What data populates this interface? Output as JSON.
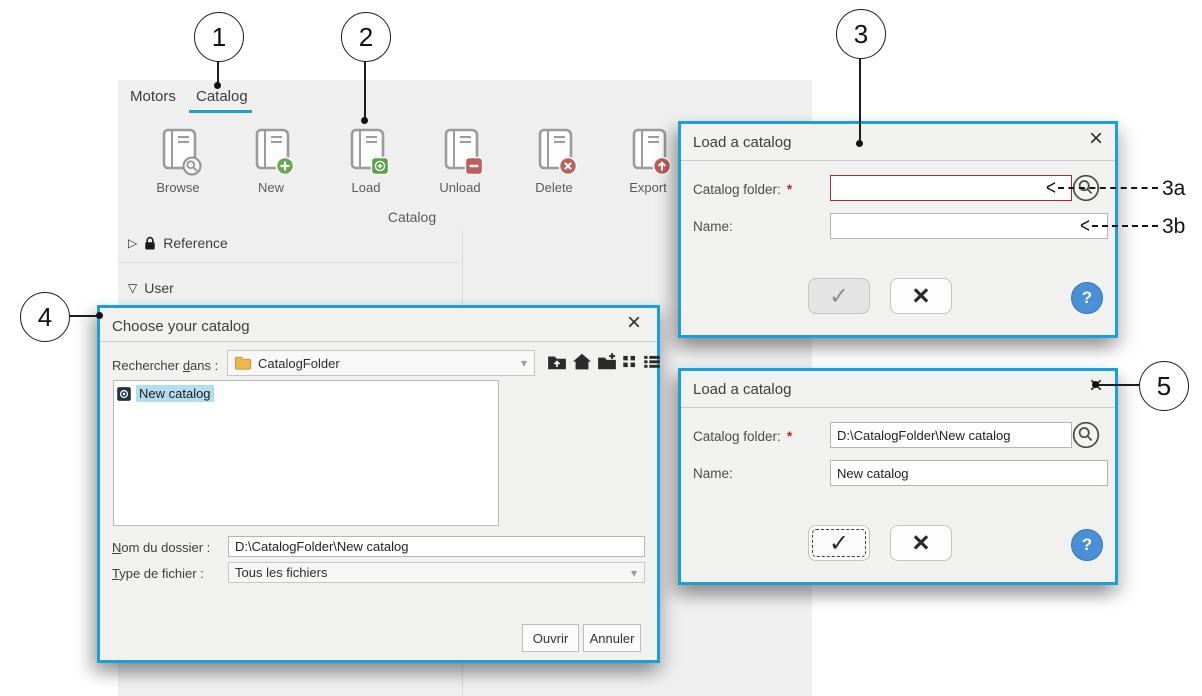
{
  "colors": {
    "accent": "#1b9fd8",
    "error_red": "#b5282a",
    "help_blue": "#4a90d6",
    "panel_bg": "#efefef"
  },
  "icons": {
    "close": "×",
    "check": "✓",
    "cross": "×",
    "asterisk": "*",
    "help": "?",
    "tri_right": "▷",
    "tri_down": "▽",
    "dropdown": "▾",
    "arrow_left": "<"
  },
  "ribbon": {
    "tabs": [
      {
        "label": "Motors"
      },
      {
        "label": "Catalog"
      }
    ],
    "active_tab": "Catalog",
    "actions": [
      {
        "label": "Browse",
        "icon": "book-search"
      },
      {
        "label": "New",
        "icon": "book-add-circle"
      },
      {
        "label": "Load",
        "icon": "book-load-square"
      },
      {
        "label": "Unload",
        "icon": "book-unload-square"
      },
      {
        "label": "Delete",
        "icon": "book-delete-circle"
      },
      {
        "label": "Export",
        "icon": "book-export-circle"
      }
    ],
    "group_label": "Catalog"
  },
  "tree": {
    "reference_label": "Reference",
    "user_label": "User"
  },
  "callouts": {
    "n1": "1",
    "n2": "2",
    "n3": "3",
    "n4": "4",
    "n5": "5",
    "n3a": "3a",
    "n3b": "3b"
  },
  "dialog_load_empty": {
    "title": "Load a catalog",
    "catalog_folder_label": "Catalog folder:",
    "catalog_folder_value": "",
    "name_label": "Name:",
    "name_value": ""
  },
  "dialog_load_filled": {
    "title": "Load a catalog",
    "catalog_folder_label": "Catalog folder:",
    "catalog_folder_value": "D:\\CatalogFolder\\New catalog",
    "name_label": "Name:",
    "name_value": "New catalog"
  },
  "file_dialog": {
    "title": "Choose your catalog",
    "look_in_pre": "Rechercher ",
    "look_in_u": "d",
    "look_in_post": "ans :",
    "look_in_value": "CatalogFolder",
    "file_item": "New catalog",
    "folder_name_u": "N",
    "folder_name_post": "om du dossier :",
    "folder_name_value": "D:\\CatalogFolder\\New catalog",
    "file_type_u": "T",
    "file_type_post": "ype de fichier :",
    "file_type_value": "Tous les fichiers",
    "open_label": "Ouvrir",
    "cancel_label": "Annuler"
  }
}
